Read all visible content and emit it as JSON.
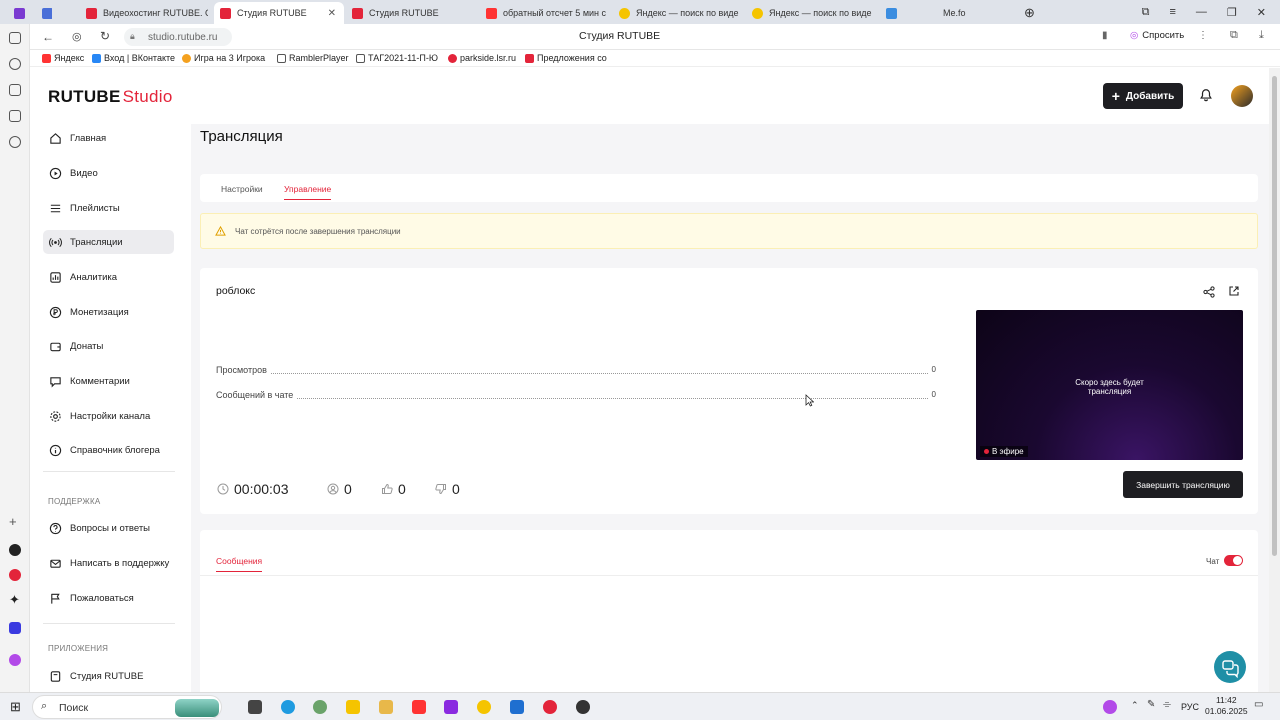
{
  "browser": {
    "tabs": [
      {
        "title": "Видеохостинг RUTUBE. С",
        "active": false
      },
      {
        "title": "Студия RUTUBE",
        "active": true
      },
      {
        "title": "Студия RUTUBE",
        "active": false
      },
      {
        "title": "обратный отсчет 5 мин с",
        "active": false
      },
      {
        "title": "Яндекс — поиск по виде",
        "active": false
      },
      {
        "title": "Яндекс — поиск по виде",
        "active": false
      },
      {
        "title": "Me.fo",
        "active": false
      }
    ],
    "address": "studio.rutube.ru",
    "page_title": "Студия RUTUBE",
    "ask_label": "Спросить",
    "bookmarks": [
      "Яндекс",
      "Вход | ВКонтакте",
      "Игра на 3 Игрока",
      "RamblerPlayer",
      "ТАГ2021-11-П-Ю",
      "parkside.lsr.ru",
      "Предложения со"
    ]
  },
  "header": {
    "logo_main": "RUTUBE",
    "logo_sub": "Studio",
    "add_button": "Добавить"
  },
  "sidebar": {
    "items": [
      {
        "label": "Главная",
        "icon": "home-icon"
      },
      {
        "label": "Видео",
        "icon": "video-icon"
      },
      {
        "label": "Плейлисты",
        "icon": "playlist-icon"
      },
      {
        "label": "Трансляции",
        "icon": "broadcast-icon",
        "active": true
      },
      {
        "label": "Аналитика",
        "icon": "analytics-icon"
      },
      {
        "label": "Монетизация",
        "icon": "ruble-icon"
      },
      {
        "label": "Донаты",
        "icon": "wallet-icon"
      },
      {
        "label": "Комментарии",
        "icon": "comment-icon"
      },
      {
        "label": "Настройки канала",
        "icon": "gear-icon"
      },
      {
        "label": "Справочник блогера",
        "icon": "book-icon"
      }
    ],
    "support_heading": "ПОДДЕРЖКА",
    "support_items": [
      {
        "label": "Вопросы и ответы",
        "icon": "question-icon"
      },
      {
        "label": "Написать в поддержку",
        "icon": "mail-icon"
      },
      {
        "label": "Пожаловаться",
        "icon": "flag-icon"
      }
    ],
    "apps_heading": "ПРИЛОЖЕНИЯ",
    "apps_items": [
      {
        "label": "Студия RUTUBE",
        "icon": "studio-icon"
      }
    ]
  },
  "main": {
    "title": "Трансляция",
    "tabs": [
      "Настройки",
      "Управление"
    ],
    "active_tab": "Управление",
    "warning": "Чат сотрётся после завершения трансляции",
    "stream": {
      "name": "роблокс",
      "stats": [
        {
          "label": "Просмотров",
          "value": "0"
        },
        {
          "label": "Сообщений в чате",
          "value": "0"
        }
      ],
      "preview_text_line1": "Скоро здесь будет",
      "preview_text_line2": "трансляция",
      "live_badge": "В эфире",
      "duration": "00:00:03",
      "viewers": "0",
      "likes": "0",
      "dislikes": "0",
      "end_button": "Завершить трансляцию"
    },
    "messages_tab": "Сообщения",
    "chat_label": "Чат",
    "chat_enabled": true
  },
  "taskbar": {
    "search": "Поиск",
    "lang": "РУС",
    "time": "11:42",
    "date": "01.06.2025"
  },
  "colors": {
    "accent": "#e3243a",
    "dark_button": "#1e1e22",
    "warning_bg": "#fffbe6",
    "help_button": "#1f8fa6"
  }
}
